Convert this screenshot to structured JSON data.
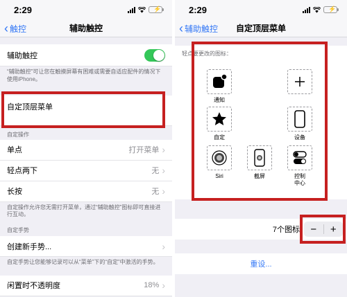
{
  "status_time": "2:29",
  "left": {
    "back_label": "触控",
    "title": "辅助触控",
    "assistive_touch": {
      "label": "辅助触控",
      "enabled": true
    },
    "assistive_touch_footer": "“辅助触控”可让您在触摸屏幕有困难或需要自适应配件的情况下使用iPhone。",
    "top_menu": {
      "label": "自定顶层菜单"
    },
    "custom_actions_header": "自定操作",
    "actions": [
      {
        "label": "单点",
        "value": "打开菜单"
      },
      {
        "label": "轻点两下",
        "value": "无"
      },
      {
        "label": "长按",
        "value": "无"
      }
    ],
    "actions_footer": "自定操作允许您无需打开菜单，通过“辅助触控”图标即可直接进行互动。",
    "gestures_header": "自定手势",
    "create_gesture": {
      "label": "创建新手势..."
    },
    "gesture_footer": "自定手势让您能够记录可以从“菜单”下的“自定”中激活的手势。",
    "idle_opacity": {
      "label": "闲置时不透明度",
      "value": "18%"
    }
  },
  "right": {
    "back_label": "辅助触控",
    "title": "自定顶层菜单",
    "hint": "轻点要更改的图标：",
    "icons": [
      {
        "icon": "notification-icon",
        "label": "通知"
      },
      {
        "icon": "plus-icon",
        "label": ""
      },
      {
        "icon": "star-icon",
        "label": "自定"
      },
      {
        "icon": "device-icon",
        "label": "设备"
      },
      {
        "icon": "siri-icon",
        "label": "Siri"
      },
      {
        "icon": "screenshot-icon",
        "label": "截屏"
      },
      {
        "icon": "control-center-icon",
        "label": "控制\n中心"
      }
    ],
    "icon_count": "7个图标",
    "stepper_minus": "−",
    "stepper_plus": "+",
    "reset_label": "重设..."
  },
  "colors": {
    "accent": "#3478f6",
    "highlight": "#c62020",
    "toggle_on": "#34c759"
  }
}
